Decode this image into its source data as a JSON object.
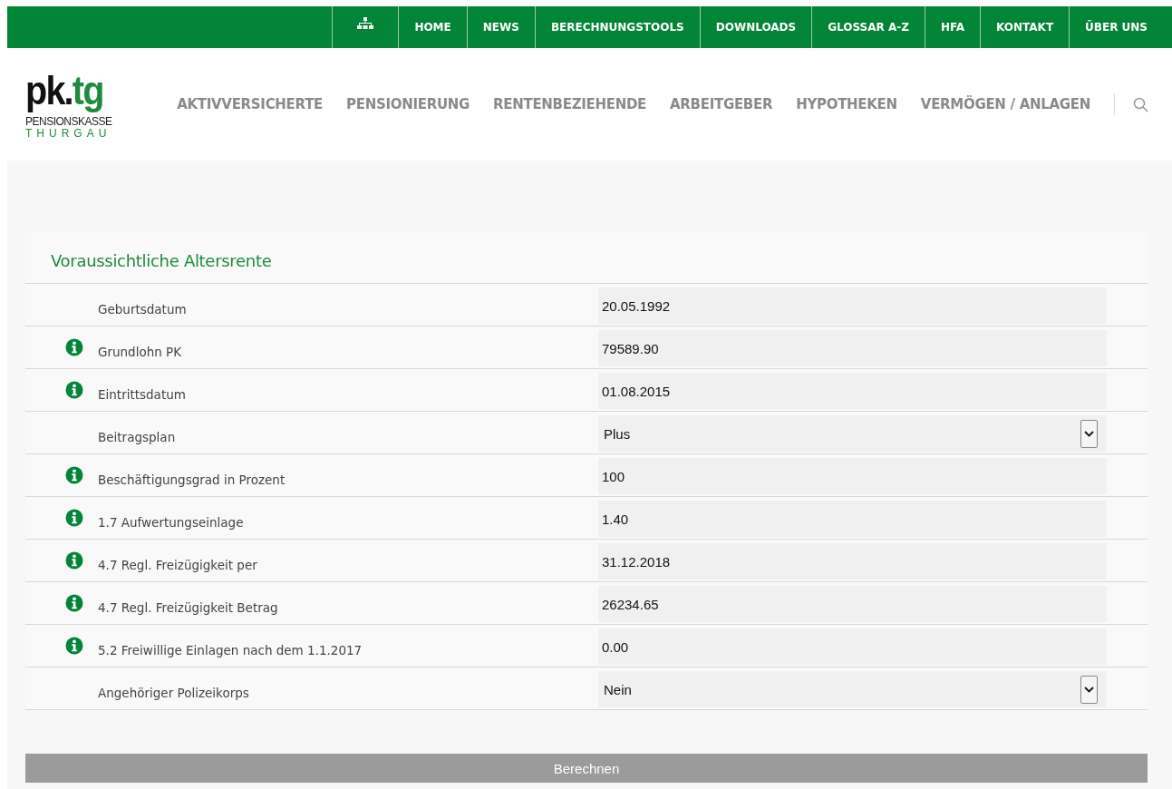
{
  "top_nav": {
    "items": [
      {
        "kind": "icon"
      },
      {
        "kind": "text",
        "label": "HOME"
      },
      {
        "kind": "text",
        "label": "NEWS"
      },
      {
        "kind": "text",
        "label": "BERECHNUNGSTOOLS"
      },
      {
        "kind": "text",
        "label": "DOWNLOADS"
      },
      {
        "kind": "text",
        "label": "GLOSSAR A-Z"
      },
      {
        "kind": "text",
        "label": "HFA"
      },
      {
        "kind": "text",
        "label": "KONTAKT"
      },
      {
        "kind": "text",
        "label": "ÜBER UNS"
      }
    ]
  },
  "logo": {
    "wordmark": "pk.",
    "wordmark_accent": "tg",
    "line_1": "PENSIONSKASSE",
    "line_2": "THURGAU"
  },
  "main_nav": {
    "items": [
      "AKTIVVERSICHERTE",
      "PENSIONIERUNG",
      "RENTENBEZIEHENDE",
      "ARBEITGEBER",
      "HYPOTHEKEN",
      "VERMÖGEN / ANLAGEN"
    ]
  },
  "form": {
    "title": "Voraussichtliche Altersrente",
    "rows": [
      {
        "label": "Geburtsdatum",
        "info": false,
        "kind": "input",
        "value": "20.05.1992"
      },
      {
        "label": "Grundlohn PK",
        "info": true,
        "kind": "input",
        "value": "79589.90"
      },
      {
        "label": "Eintrittsdatum",
        "info": true,
        "kind": "input",
        "value": "01.08.2015"
      },
      {
        "label": "Beitragsplan",
        "info": false,
        "kind": "select",
        "value": "Plus"
      },
      {
        "label": "Beschäftigungsgrad in Prozent",
        "info": true,
        "kind": "input",
        "value": "100"
      },
      {
        "label": "1.7 Aufwertungseinlage",
        "info": true,
        "kind": "input",
        "value": "1.40"
      },
      {
        "label": "4.7 Regl. Freizügigkeit per",
        "info": true,
        "kind": "input",
        "value": "31.12.2018"
      },
      {
        "label": "4.7 Regl. Freizügigkeit Betrag",
        "info": true,
        "kind": "input",
        "value": "26234.65"
      },
      {
        "label": "5.2 Freiwillige Einlagen nach dem 1.1.2017",
        "info": true,
        "kind": "input",
        "value": "0.00"
      },
      {
        "label": "Angehöriger Polizeikorps",
        "info": false,
        "kind": "select",
        "value": "Nein"
      }
    ],
    "submit": "Berechnen"
  }
}
